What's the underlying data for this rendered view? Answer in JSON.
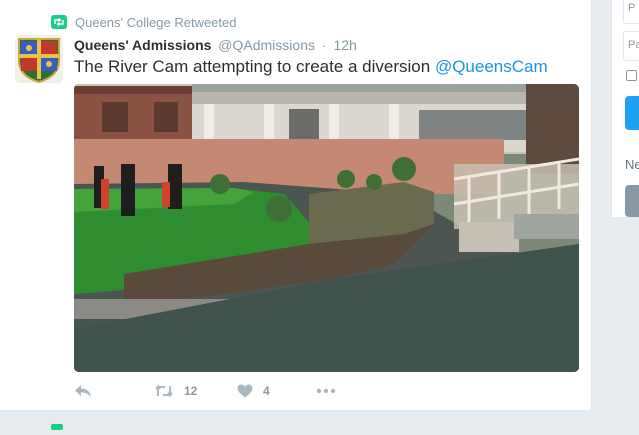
{
  "retweet_context": {
    "text": "Queens' College Retweeted",
    "icon": "retweet-icon"
  },
  "author": {
    "name": "Queens' Admissions",
    "handle": "@QAdmissions",
    "separator": "·",
    "time": "12h"
  },
  "tweet": {
    "text": "The River Cam attempting to create a diversion ",
    "mention": "@QueensCam"
  },
  "actions": {
    "reply": {
      "icon": "reply-icon"
    },
    "retweet": {
      "icon": "retweet-icon",
      "count": "12"
    },
    "like": {
      "icon": "heart-icon",
      "count": "4"
    },
    "more": {
      "icon": "more-icon"
    }
  },
  "sidebar": {
    "input1_placeholder": "P",
    "input2_placeholder": "Pa",
    "section_text": "Ne"
  },
  "colors": {
    "link": "#1b95e0",
    "retweet_green": "#19cf86",
    "muted": "#8899a6",
    "button_blue": "#1da1f2",
    "button_gray": "#8899a6"
  }
}
